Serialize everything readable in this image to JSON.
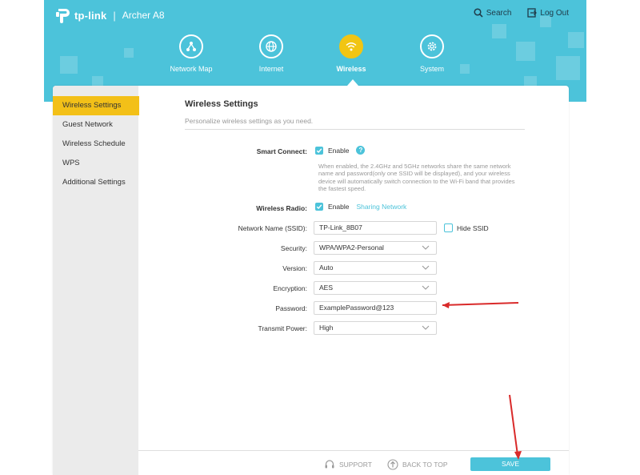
{
  "header": {
    "brand": "tp-link",
    "separator": "|",
    "model": "Archer A8",
    "search_label": "Search",
    "logout_label": "Log Out"
  },
  "nav": {
    "items": [
      {
        "label": "Network Map",
        "icon": "network-map-icon"
      },
      {
        "label": "Internet",
        "icon": "globe-icon"
      },
      {
        "label": "Wireless",
        "icon": "wifi-icon",
        "active": true
      },
      {
        "label": "System",
        "icon": "gear-icon"
      }
    ]
  },
  "sidebar": {
    "items": [
      {
        "label": "Wireless Settings",
        "active": true
      },
      {
        "label": "Guest Network"
      },
      {
        "label": "Wireless Schedule"
      },
      {
        "label": "WPS"
      },
      {
        "label": "Additional Settings"
      }
    ]
  },
  "main": {
    "title": "Wireless Settings",
    "subtitle": "Personalize wireless settings as you need.",
    "smart_connect": {
      "label": "Smart Connect:",
      "checkbox_label": "Enable",
      "checked": true,
      "help_icon": "question-icon",
      "description": "When enabled, the 2.4GHz and 5GHz networks share the same network name and password(only one SSID will be displayed), and your wireless device will automatically switch connection to the Wi-Fi band that provides the fastest speed."
    },
    "wireless_radio": {
      "label": "Wireless Radio:",
      "checkbox_label": "Enable",
      "checked": true,
      "link": "Sharing Network"
    },
    "ssid": {
      "label": "Network Name (SSID):",
      "value": "TP-Link_8B07",
      "hide_label": "Hide SSID",
      "hide_checked": false
    },
    "security": {
      "label": "Security:",
      "value": "WPA/WPA2-Personal"
    },
    "version": {
      "label": "Version:",
      "value": "Auto"
    },
    "encryption": {
      "label": "Encryption:",
      "value": "AES"
    },
    "password": {
      "label": "Password:",
      "value": "ExamplePassword@123"
    },
    "transmit_power": {
      "label": "Transmit Power:",
      "value": "High"
    }
  },
  "footer": {
    "support_label": "SUPPORT",
    "back_to_top_label": "BACK TO TOP",
    "save_label": "SAVE"
  },
  "colors": {
    "banner": "#4cc3da",
    "accent_yellow": "#f3c018",
    "annotation_arrow": "#d92a2a"
  }
}
